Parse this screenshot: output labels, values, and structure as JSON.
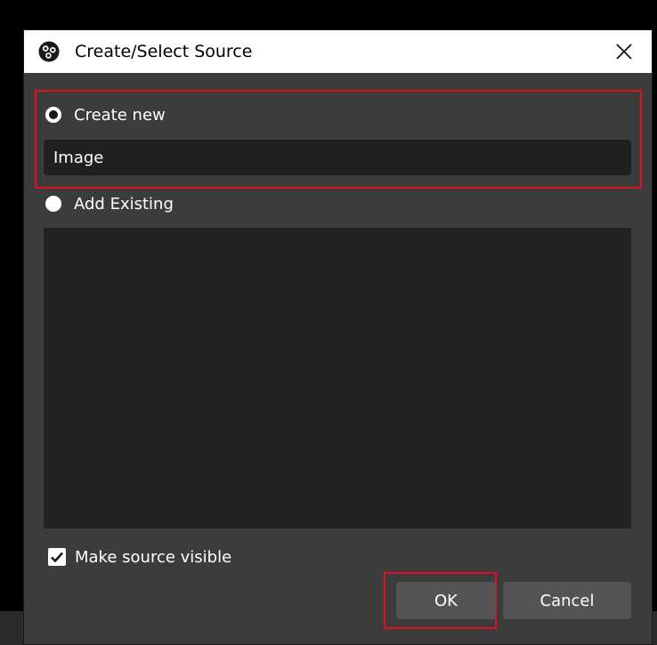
{
  "dialog": {
    "title": "Create/Select Source",
    "icon": "obs-logo-icon",
    "close_icon": "close-icon"
  },
  "create_new": {
    "label": "Create new",
    "selected": true,
    "name_value": "Image"
  },
  "add_existing": {
    "label": "Add Existing",
    "selected": false,
    "items": []
  },
  "make_visible": {
    "label": "Make source visible",
    "checked": true
  },
  "buttons": {
    "ok_label": "OK",
    "cancel_label": "Cancel"
  },
  "colors": {
    "dialog_bg": "#3c3c3c",
    "input_bg": "#202020",
    "list_bg": "#232323",
    "button_bg": "#545454",
    "highlight": "#e01020"
  }
}
